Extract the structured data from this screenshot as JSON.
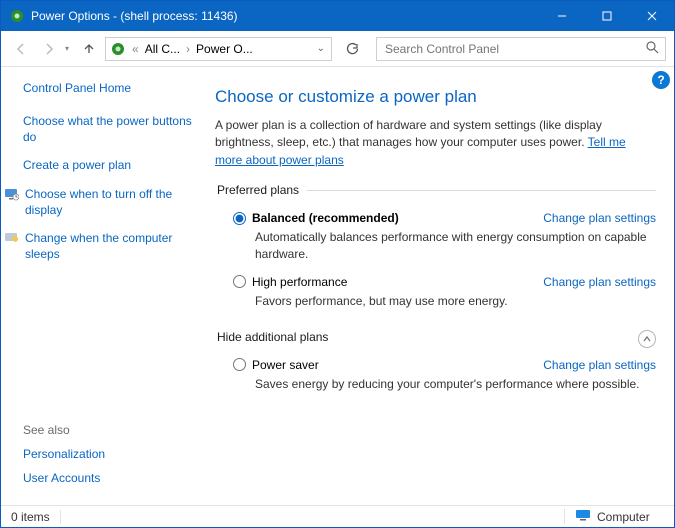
{
  "window": {
    "title": "Power Options - (shell process: 11436)"
  },
  "breadcrumb": {
    "level1": "All C...",
    "level2": "Power O..."
  },
  "search": {
    "placeholder": "Search Control Panel"
  },
  "sidebar": {
    "cph": "Control Panel Home",
    "items": [
      {
        "label": "Choose what the power buttons do",
        "icon": ""
      },
      {
        "label": "Create a power plan",
        "icon": ""
      },
      {
        "label": "Choose when to turn off the display",
        "icon": "display"
      },
      {
        "label": "Change when the computer sleeps",
        "icon": "sleep"
      }
    ],
    "see_also_hdr": "See also",
    "see_also": [
      "Personalization",
      "User Accounts"
    ]
  },
  "main": {
    "heading": "Choose or customize a power plan",
    "intro_pre": "A power plan is a collection of hardware and system settings (like display brightness, sleep, etc.) that manages how your computer uses power. ",
    "intro_link": "Tell me more about power plans",
    "preferred_legend": "Preferred plans",
    "additional_legend": "Hide additional plans",
    "change_label": "Change plan settings",
    "plans_preferred": [
      {
        "name": "Balanced (recommended)",
        "desc": "Automatically balances performance with energy consumption on capable hardware.",
        "checked": true,
        "bold": true
      },
      {
        "name": "High performance",
        "desc": "Favors performance, but may use more energy.",
        "checked": false,
        "bold": false
      }
    ],
    "plans_additional": [
      {
        "name": "Power saver",
        "desc": "Saves energy by reducing your computer's performance where possible.",
        "checked": false,
        "bold": false
      }
    ]
  },
  "status": {
    "items": "0 items",
    "computer": "Computer"
  }
}
